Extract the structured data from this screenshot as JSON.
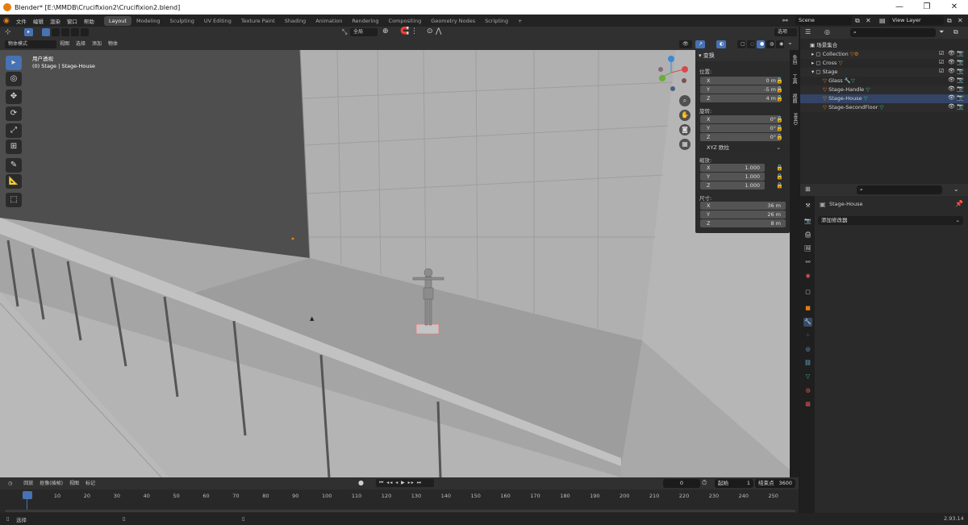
{
  "window": {
    "title": "Blender* [E:\\MMDB\\Crucifixion2\\Crucifixion2.blend]",
    "minimize": "—",
    "maximize": "❐",
    "close": "✕"
  },
  "menus": [
    "文件",
    "编辑",
    "渲染",
    "窗口",
    "帮助"
  ],
  "workspaces": [
    "Layout",
    "Modeling",
    "Sculpting",
    "UV Editing",
    "Texture Paint",
    "Shading",
    "Animation",
    "Rendering",
    "Compositing",
    "Geometry Nodes",
    "Scripting"
  ],
  "active_workspace": "Layout",
  "scene": "Scene",
  "view_layer": "View Layer",
  "viewport_header": {
    "mode": "物体模式",
    "menus": [
      "视图",
      "选择",
      "添加",
      "物体"
    ],
    "transform_orientation": "全局",
    "options": "选项"
  },
  "viewport": {
    "view_name": "用户透视",
    "context": "(0) Stage | Stage-House"
  },
  "npanel": {
    "title": "变换",
    "location_label": "位置:",
    "location": [
      [
        "X",
        "0 m"
      ],
      [
        "Y",
        "-5 m"
      ],
      [
        "Z",
        "4 m"
      ]
    ],
    "rotation_label": "旋转:",
    "rotation": [
      [
        "X",
        "0°"
      ],
      [
        "Y",
        "0°"
      ],
      [
        "Z",
        "0°"
      ]
    ],
    "rotation_mode": "XYZ 欧拉",
    "scale_label": "缩放:",
    "scale": [
      [
        "X",
        "1.000"
      ],
      [
        "Y",
        "1.000"
      ],
      [
        "Z",
        "1.000"
      ]
    ],
    "dimensions_label": "尺寸:",
    "dimensions": [
      [
        "X",
        "36 m"
      ],
      [
        "Y",
        "26 m"
      ],
      [
        "Z",
        "8 m"
      ]
    ],
    "side_tabs": [
      "条目",
      "工具",
      "视图",
      "MMD"
    ]
  },
  "outliner": {
    "root": "场景集合",
    "rows": [
      {
        "name": "Collection",
        "depth": 1,
        "type": "collection"
      },
      {
        "name": "Cross",
        "depth": 1,
        "type": "collection"
      },
      {
        "name": "Stage",
        "depth": 1,
        "type": "collection"
      },
      {
        "name": "Glass",
        "depth": 2,
        "type": "object"
      },
      {
        "name": "Stage-Handle",
        "depth": 2,
        "type": "object"
      },
      {
        "name": "Stage-House",
        "depth": 2,
        "type": "object"
      },
      {
        "name": "Stage-SecondFloor",
        "depth": 2,
        "type": "object"
      }
    ]
  },
  "properties": {
    "object_name": "Stage-House",
    "add_modifier": "添加修改器"
  },
  "timeline": {
    "menus": [
      "回放",
      "抠像(插帧)",
      "视图",
      "标记"
    ],
    "current_frame": "0",
    "start_label": "起始",
    "start": "1",
    "end_label": "结束点",
    "end": "3600",
    "ticks": [
      "0",
      "10",
      "20",
      "30",
      "40",
      "50",
      "60",
      "70",
      "80",
      "90",
      "100",
      "110",
      "120",
      "130",
      "140",
      "150",
      "160",
      "170",
      "180",
      "190",
      "200",
      "210",
      "220",
      "230",
      "240",
      "250"
    ]
  },
  "status": {
    "left": "选择",
    "version": "2.93.14"
  },
  "colors": {
    "accent": "#4772b3",
    "orange": "#e87d0d",
    "viewport_bg": "#a9a9a9"
  }
}
